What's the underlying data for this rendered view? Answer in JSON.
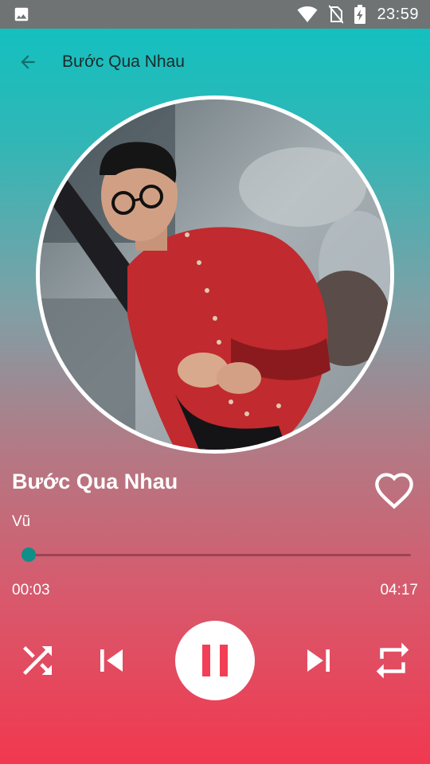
{
  "status_bar": {
    "time": "23:59",
    "icons": [
      "image-notification-icon",
      "wifi-icon",
      "no-sim-icon",
      "battery-charging-icon"
    ]
  },
  "app_bar": {
    "title": "Bước Qua Nhau",
    "back_icon": "arrow-back-icon"
  },
  "now_playing": {
    "title": "Bước Qua Nhau",
    "artist": "Vũ",
    "liked": false,
    "current_time": "00:03",
    "total_time": "04:17",
    "progress": 0.012
  },
  "controls": {
    "shuffle_icon": "shuffle-icon",
    "previous_icon": "skip-previous-icon",
    "play_state": "playing",
    "pause_icon": "pause-icon",
    "next_icon": "skip-next-icon",
    "repeat_icon": "repeat-icon"
  },
  "colors": {
    "gradient_top": "#0dc2c2",
    "gradient_bottom": "#f1384f",
    "accent": "#0f8f8a",
    "status_bar": "#6f7373"
  }
}
